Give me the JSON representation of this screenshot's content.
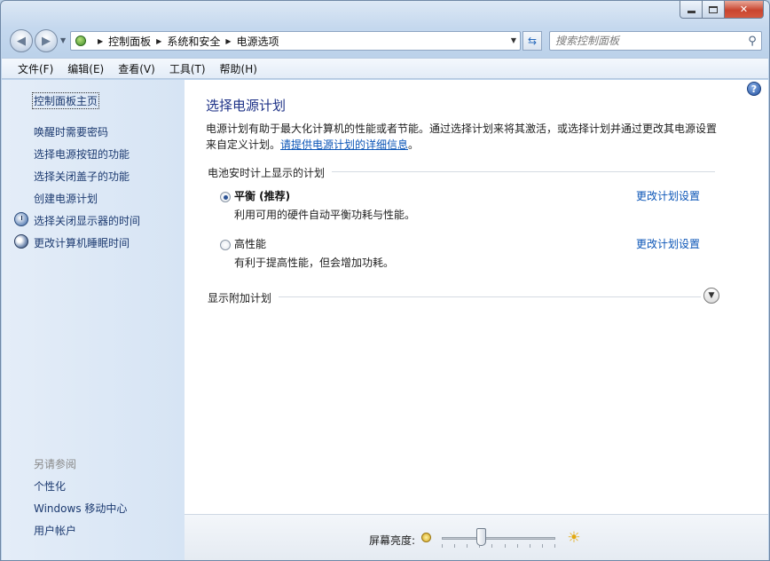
{
  "address": {
    "breadcrumb": [
      "控制面板",
      "系统和安全",
      "电源选项"
    ],
    "search_placeholder": "搜索控制面板"
  },
  "menu": [
    "文件(F)",
    "编辑(E)",
    "查看(V)",
    "工具(T)",
    "帮助(H)"
  ],
  "sidebar": {
    "home": "控制面板主页",
    "links": [
      "唤醒时需要密码",
      "选择电源按钮的功能",
      "选择关闭盖子的功能",
      "创建电源计划",
      "选择关闭显示器的时间",
      "更改计算机睡眠时间"
    ],
    "see_also_title": "另请参阅",
    "see_also": [
      "个性化",
      "Windows 移动中心",
      "用户帐户"
    ]
  },
  "main": {
    "title": "选择电源计划",
    "intro_text": "电源计划有助于最大化计算机的性能或者节能。通过选择计划来将其激活，或选择计划并通过更改其电源设置来自定义计划。",
    "intro_link": "请提供电源计划的详细信息",
    "intro_end": "。",
    "battery_header": "电池安时计上显示的计划",
    "plans": [
      {
        "name": "平衡 (推荐)",
        "desc": "利用可用的硬件自动平衡功耗与性能。",
        "link": "更改计划设置",
        "selected": true
      },
      {
        "name": "高性能",
        "desc": "有利于提高性能，但会增加功耗。",
        "link": "更改计划设置",
        "selected": false
      }
    ],
    "additional_header": "显示附加计划"
  },
  "brightness": {
    "label": "屏幕亮度:",
    "level": 0.35
  }
}
